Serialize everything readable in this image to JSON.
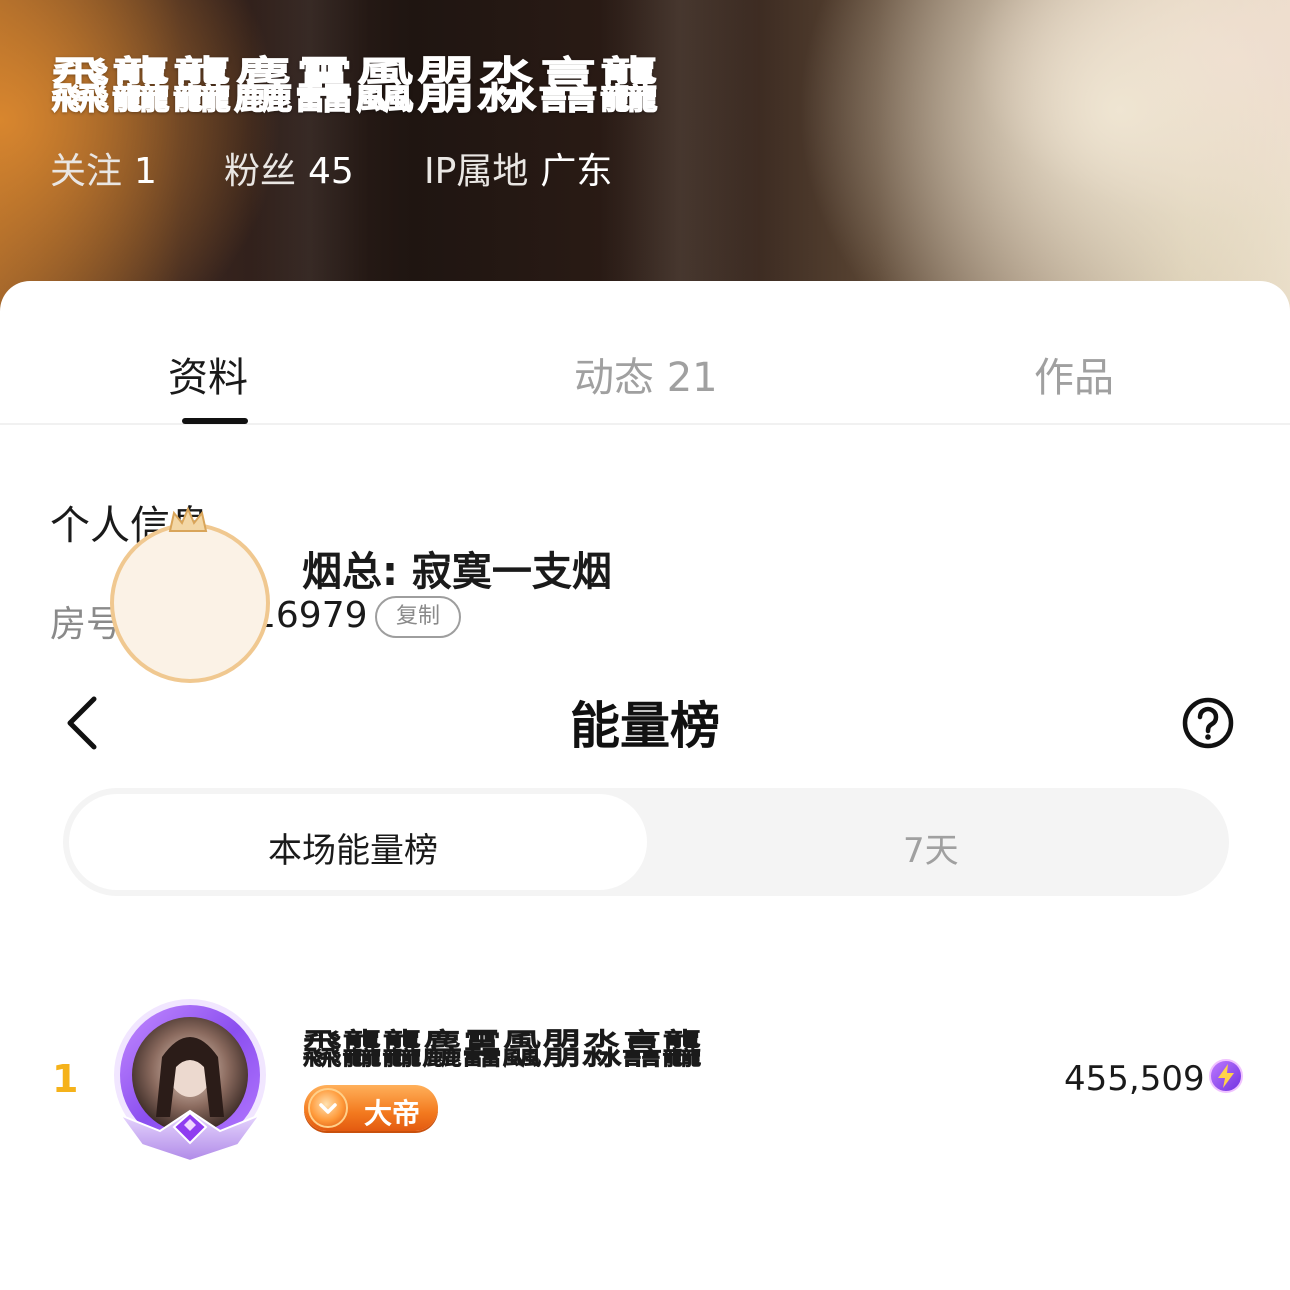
{
  "profile": {
    "name": "飝龘龘麤靐飍朤淼譶龘",
    "follow_label": "关注",
    "follow_count": "1",
    "fans_label": "粉丝",
    "fans_count": "45",
    "ip_label": "IP属地",
    "ip_value": "广东"
  },
  "tabs": [
    {
      "label": "资料",
      "active": true
    },
    {
      "label": "动态 21",
      "active": false
    },
    {
      "label": "作品",
      "active": false
    }
  ],
  "info": {
    "section_title": "个人信息",
    "room_label": "房号:",
    "room_value": "16979",
    "copy_label": "复制"
  },
  "board": {
    "title": "能量榜",
    "back_icon": "chevron-left-icon",
    "help_icon": "question-circle-icon",
    "segments": [
      {
        "label": "本场能量榜",
        "active": true
      },
      {
        "label": "7天",
        "active": false
      }
    ],
    "entries": [
      {
        "rank": "1",
        "name": "飝龘龘麤靐飍朤淼譶龘",
        "badge": "大帝",
        "score": "455,509",
        "score_icon": "energy-bolt-icon"
      },
      {
        "name": "烟总: 寂寞一支烟"
      }
    ]
  },
  "colors": {
    "accent_gold": "#f5b21a",
    "badge_orange": "#f37a1f",
    "avatar_ring_purple": "#9b5cf2"
  }
}
